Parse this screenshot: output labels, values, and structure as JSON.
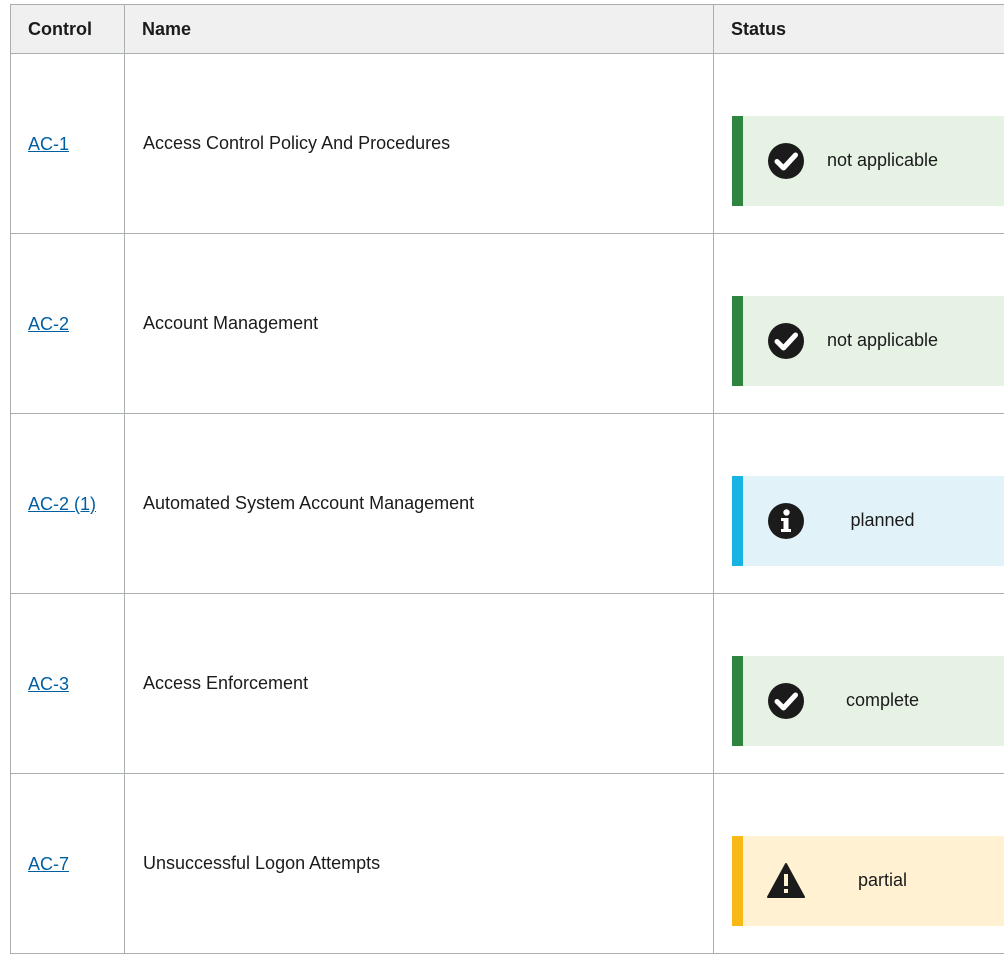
{
  "table": {
    "headers": {
      "control": "Control",
      "name": "Name",
      "status": "Status"
    },
    "rows": [
      {
        "control": "AC-1",
        "name": "Access Control Policy And Procedures",
        "status": "not applicable",
        "status_type": "success",
        "icon": "check-circle-icon"
      },
      {
        "control": "AC-2",
        "name": "Account Management",
        "status": "not applicable",
        "status_type": "success",
        "icon": "check-circle-icon"
      },
      {
        "control": "AC-2 (1)",
        "name": "Automated System Account Management",
        "status": "planned",
        "status_type": "info",
        "icon": "info-circle-icon"
      },
      {
        "control": "AC-3",
        "name": "Access Enforcement",
        "status": "complete",
        "status_type": "success",
        "icon": "check-circle-icon"
      },
      {
        "control": "AC-7",
        "name": "Unsuccessful Logon Attempts",
        "status": "partial",
        "status_type": "warning",
        "icon": "warning-triangle-icon"
      }
    ]
  },
  "colors": {
    "link": "#005ea2",
    "success_border": "#2e8540",
    "success_bg": "#e6f3e4",
    "info_border": "#19b3e3",
    "info_bg": "#e1f3f8",
    "warning_border": "#f8b916",
    "warning_bg": "#fff1d2",
    "header_bg": "#f0f0f0"
  }
}
